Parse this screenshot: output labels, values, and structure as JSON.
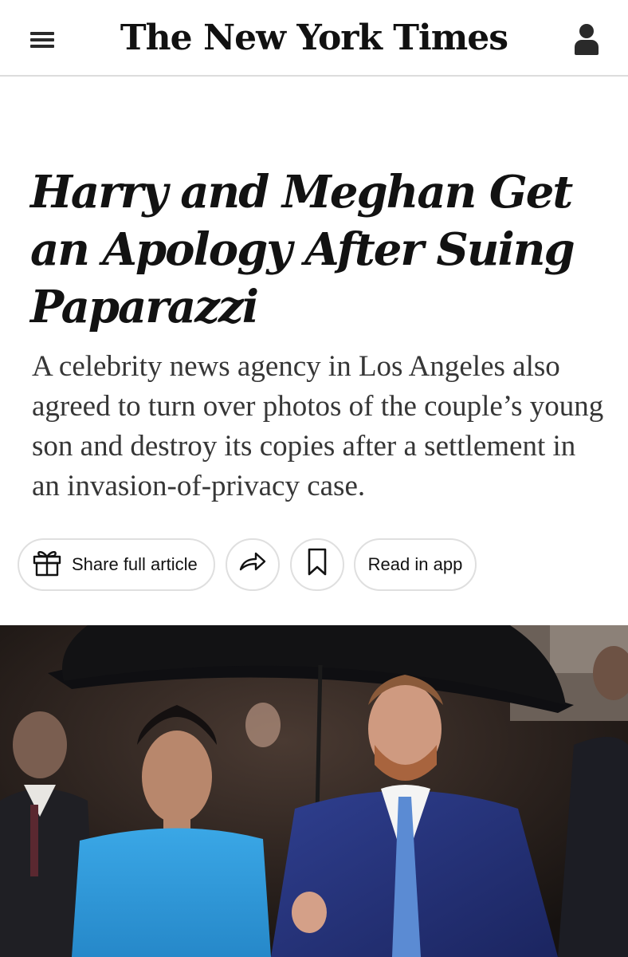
{
  "header": {
    "logo_text": "The New York Times",
    "menu_icon": "hamburger-menu-icon",
    "account_icon": "user-account-icon"
  },
  "article": {
    "headline": "Harry and Meghan Get an Apology After Suing Paparazzi",
    "summary": "A celebrity news agency in Los Angeles also agreed to turn over photos of the couple’s young son and destroy its copies after a settlement in an invasion-of-privacy case."
  },
  "actions": {
    "share_label": "Share full article",
    "share_icon": "gift-icon",
    "forward_icon": "share-arrow-icon",
    "save_icon": "bookmark-icon",
    "app_label": "Read in app"
  },
  "colors": {
    "text_primary": "#121212",
    "text_summary": "#363636",
    "divider": "#dcdcdc"
  }
}
